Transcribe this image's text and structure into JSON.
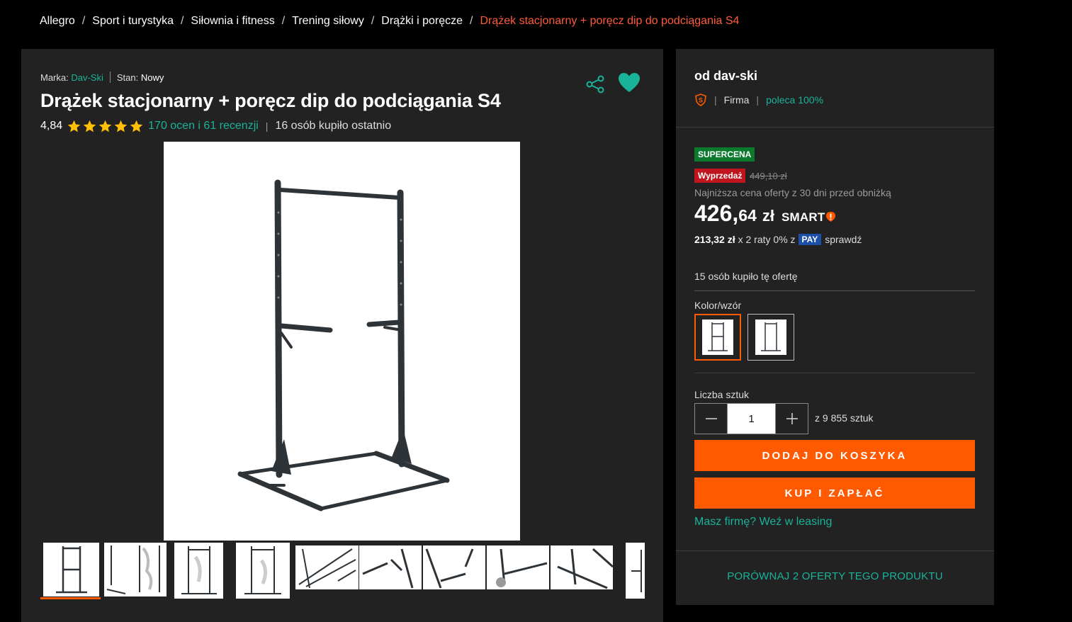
{
  "breadcrumb": {
    "items": [
      "Allegro",
      "Sport i turystyka",
      "Siłownia i fitness",
      "Trening siłowy",
      "Drążki i poręcze"
    ],
    "current": "Drążek stacjonarny + poręcz dip do podciągania S4",
    "separator": "/"
  },
  "product": {
    "brand_label": "Marka:",
    "brand": "Dav-Ski",
    "state_label": "Stan:",
    "state": "Nowy",
    "title": "Drążek stacjonarny + poręcz dip do podciągania S4",
    "rating": "4,84",
    "stars": 5,
    "reviews_link": "170 ocen i 61 recenzji",
    "recent_buyers": "16 osób kupiło ostatnio",
    "share_icon": "share-icon",
    "favorite_icon": "heart-icon",
    "thumbnail_count": 11
  },
  "seller": {
    "name": "od dav-ski",
    "type": "Firma",
    "recommend": "poleca 100%",
    "badge_icon": "super-seller-icon"
  },
  "offer": {
    "badge_supercena": "SUPERCENA",
    "badge_sale": "Wyprzedaż",
    "old_price": "449,10 zł",
    "lowest_note": "Najniższa cena oferty z 30 dni przed obniżką",
    "price_main": "426,",
    "price_cents": "64",
    "currency": "zł",
    "smart": "SMART",
    "installment_amount": "213,32 zł",
    "installment_text": "x 2 raty 0% z",
    "pay_badge": "PAY",
    "installment_link": "sprawdź",
    "bought_offer": "15 osób kupiło tę ofertę",
    "variant_label": "Kolor/wzór",
    "qty_label": "Liczba sztuk",
    "qty_value": "1",
    "qty_of": "z 9 855 sztuk",
    "add_to_cart": "DODAJ DO KOSZYKA",
    "buy_now": "KUP I ZAPŁAĆ",
    "leasing": "Masz firmę? Weź w leasing",
    "compare": "PORÓWNAJ 2 OFERTY TEGO PRODUKTU"
  },
  "colors": {
    "accent_orange": "#ff5a00",
    "link_teal": "#19b39a",
    "breadcrumb_current": "#ff5a3c",
    "supercena_green": "#0b7a2d",
    "sale_red": "#c0141e",
    "star_yellow": "#ffc107",
    "panel_bg": "#222222"
  }
}
